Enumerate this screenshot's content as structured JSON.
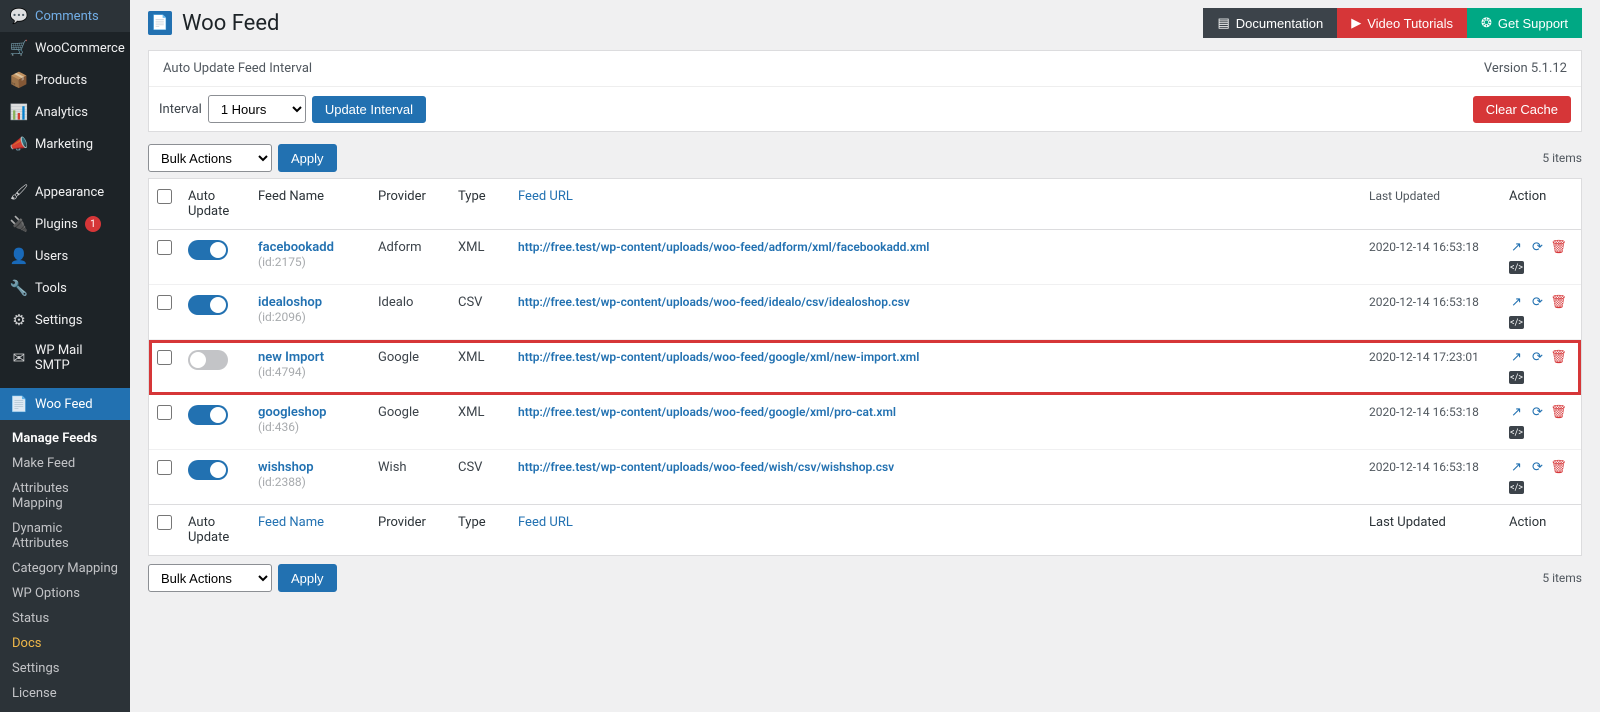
{
  "sidebar": {
    "items": [
      {
        "label": "Comments",
        "icon": "💬"
      },
      {
        "label": "WooCommerce",
        "icon": "🛒"
      },
      {
        "label": "Products",
        "icon": "📦"
      },
      {
        "label": "Analytics",
        "icon": "📊"
      },
      {
        "label": "Marketing",
        "icon": "📣"
      },
      {
        "label": "Appearance",
        "icon": "🖌"
      },
      {
        "label": "Plugins",
        "icon": "🔌",
        "badge": "1"
      },
      {
        "label": "Users",
        "icon": "👤"
      },
      {
        "label": "Tools",
        "icon": "🔧"
      },
      {
        "label": "Settings",
        "icon": "⚙"
      },
      {
        "label": "WP Mail SMTP",
        "icon": "✉"
      },
      {
        "label": "Woo Feed",
        "icon": "📄",
        "active": true
      }
    ],
    "submenu": [
      {
        "label": "Manage Feeds",
        "current": true
      },
      {
        "label": "Make Feed"
      },
      {
        "label": "Attributes Mapping"
      },
      {
        "label": "Dynamic Attributes"
      },
      {
        "label": "Category Mapping"
      },
      {
        "label": "WP Options"
      },
      {
        "label": "Status"
      },
      {
        "label": "Docs",
        "highlight": true
      },
      {
        "label": "Settings"
      },
      {
        "label": "License"
      }
    ]
  },
  "header": {
    "title": "Woo Feed",
    "docs": "Documentation",
    "video": "Video Tutorials",
    "support": "Get Support"
  },
  "panel": {
    "auto_update_label": "Auto Update Feed Interval",
    "version": "Version 5.1.12",
    "interval_label": "Interval",
    "interval_value": "1 Hours",
    "update_btn": "Update Interval",
    "clear_btn": "Clear Cache"
  },
  "toolbar": {
    "bulk_label": "Bulk Actions",
    "apply": "Apply",
    "items_count": "5 items"
  },
  "columns": {
    "auto_update": "Auto Update",
    "feed_name": "Feed Name",
    "provider": "Provider",
    "type": "Type",
    "feed_url": "Feed URL",
    "last_updated": "Last Updated",
    "action": "Action"
  },
  "rows": [
    {
      "name": "facebookadd",
      "id": "(id:2175)",
      "provider": "Adform",
      "type": "XML",
      "url": "http://free.test/wp-content/uploads/woo-feed/adform/xml/facebookadd.xml",
      "date": "2020-12-14 16:53:18",
      "on": true,
      "highlight": false
    },
    {
      "name": "idealoshop",
      "id": "(id:2096)",
      "provider": "Idealo",
      "type": "CSV",
      "url": "http://free.test/wp-content/uploads/woo-feed/idealo/csv/idealoshop.csv",
      "date": "2020-12-14 16:53:18",
      "on": true,
      "highlight": false
    },
    {
      "name": "new Import",
      "id": "(id:4794)",
      "provider": "Google",
      "type": "XML",
      "url": "http://free.test/wp-content/uploads/woo-feed/google/xml/new-import.xml",
      "date": "2020-12-14 17:23:01",
      "on": false,
      "highlight": true
    },
    {
      "name": "googleshop",
      "id": "(id:436)",
      "provider": "Google",
      "type": "XML",
      "url": "http://free.test/wp-content/uploads/woo-feed/google/xml/pro-cat.xml",
      "date": "2020-12-14 16:53:18",
      "on": true,
      "highlight": false
    },
    {
      "name": "wishshop",
      "id": "(id:2388)",
      "provider": "Wish",
      "type": "CSV",
      "url": "http://free.test/wp-content/uploads/woo-feed/wish/csv/wishshop.csv",
      "date": "2020-12-14 16:53:18",
      "on": true,
      "highlight": false
    }
  ]
}
